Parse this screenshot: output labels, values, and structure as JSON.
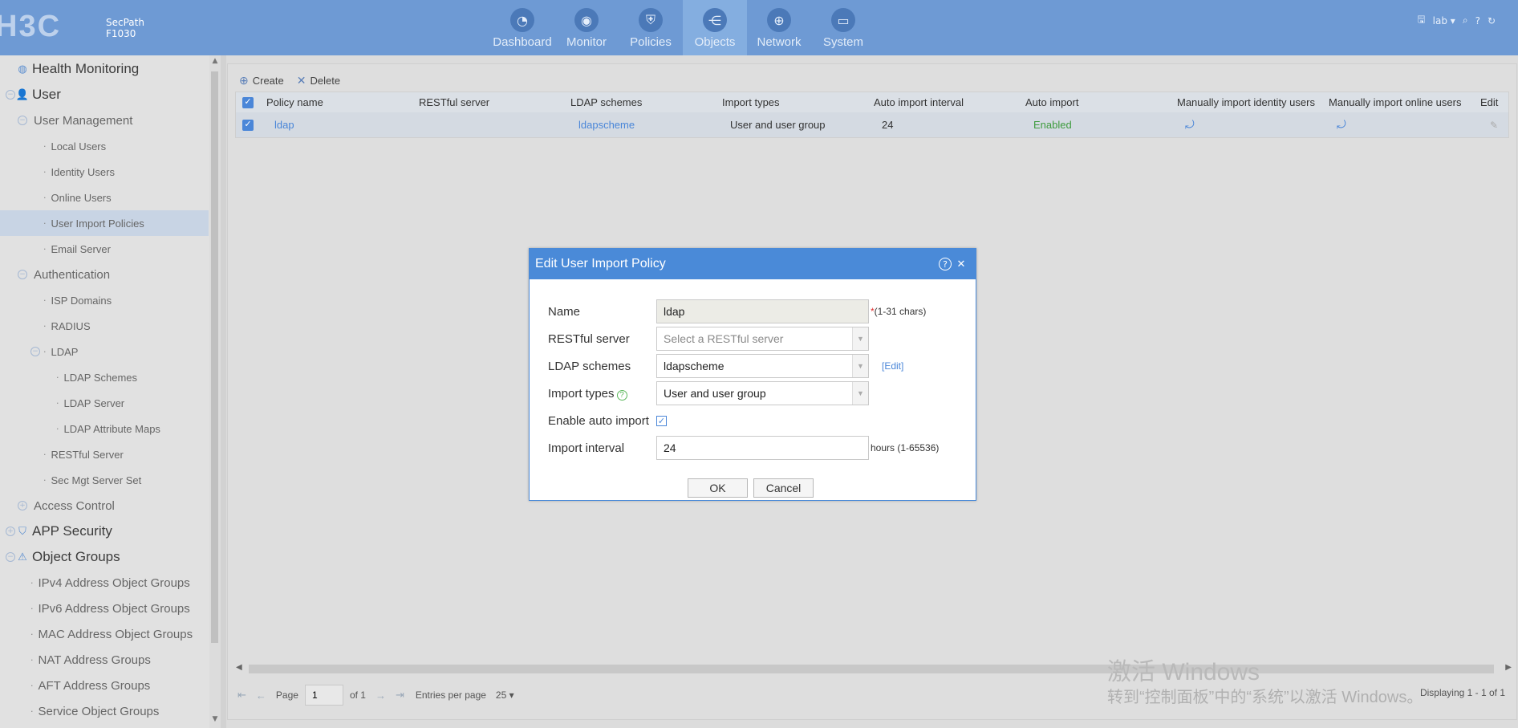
{
  "brand": {
    "logo_text": "H3C",
    "product_line1": "SecPath",
    "product_line2": "F1030"
  },
  "nav": [
    {
      "label": "Dashboard",
      "icon": "gauge-icon"
    },
    {
      "label": "Monitor",
      "icon": "eye-icon"
    },
    {
      "label": "Policies",
      "icon": "shield-icon"
    },
    {
      "label": "Objects",
      "icon": "share-icon",
      "active": true
    },
    {
      "label": "Network",
      "icon": "globe-icon"
    },
    {
      "label": "System",
      "icon": "monitor-icon"
    }
  ],
  "user": {
    "name": "lab"
  },
  "sidebar": {
    "items": [
      {
        "label": "Health Monitoring"
      },
      {
        "label": "User"
      },
      {
        "label": "User Management"
      },
      {
        "label": "Local Users"
      },
      {
        "label": "Identity Users"
      },
      {
        "label": "Online Users"
      },
      {
        "label": "User Import Policies",
        "selected": true
      },
      {
        "label": "Email Server"
      },
      {
        "label": "Authentication"
      },
      {
        "label": "ISP Domains"
      },
      {
        "label": "RADIUS"
      },
      {
        "label": "LDAP"
      },
      {
        "label": "LDAP Schemes"
      },
      {
        "label": "LDAP Server"
      },
      {
        "label": "LDAP Attribute Maps"
      },
      {
        "label": "RESTful Server"
      },
      {
        "label": "Sec Mgt Server Set"
      },
      {
        "label": "Access Control"
      },
      {
        "label": "APP Security"
      },
      {
        "label": "Object Groups"
      },
      {
        "label": "IPv4 Address Object Groups"
      },
      {
        "label": "IPv6 Address Object Groups"
      },
      {
        "label": "MAC Address Object Groups"
      },
      {
        "label": "NAT Address Groups"
      },
      {
        "label": "AFT Address Groups"
      },
      {
        "label": "Service Object Groups"
      }
    ]
  },
  "toolbar": {
    "create_label": "Create",
    "delete_label": "Delete"
  },
  "table": {
    "columns": [
      "Policy name",
      "RESTful server",
      "LDAP schemes",
      "Import types",
      "Auto import interval",
      "Auto import",
      "Manually import identity users",
      "Manually import online users",
      "Edit"
    ],
    "rows": [
      {
        "policy_name": "ldap",
        "restful_server": "",
        "ldap_schemes": "ldapscheme",
        "import_types": "User and user group",
        "auto_import_interval": "24",
        "auto_import": "Enabled"
      }
    ]
  },
  "pager": {
    "page_label": "Page",
    "page_value": "1",
    "of_label": "of 1",
    "entries_label": "Entries per page",
    "entries_value": "25",
    "display_info": "Displaying 1 - 1 of 1"
  },
  "watermark": {
    "line1": "激活 Windows",
    "line2": "转到“控制面板”中的“系统”以激活 Windows。"
  },
  "dialog": {
    "title": "Edit User Import Policy",
    "name_label": "Name",
    "name_value": "ldap",
    "name_hint": "(1-31 chars)",
    "restful_label": "RESTful server",
    "restful_placeholder": "Select a RESTful server",
    "ldap_label": "LDAP schemes",
    "ldap_value": "ldapscheme",
    "ldap_edit": "[Edit]",
    "import_label": "Import types",
    "import_value": "User and user group",
    "auto_label": "Enable auto import",
    "auto_checked": true,
    "interval_label": "Import interval",
    "interval_value": "24",
    "interval_hint": "hours (1-65536)",
    "ok_label": "OK",
    "cancel_label": "Cancel"
  },
  "colors": {
    "header_bg": "#6e9ad4",
    "accent": "#4a8ad8",
    "selected_bg": "#c8d4e4",
    "enabled": "#3d9b3d"
  }
}
